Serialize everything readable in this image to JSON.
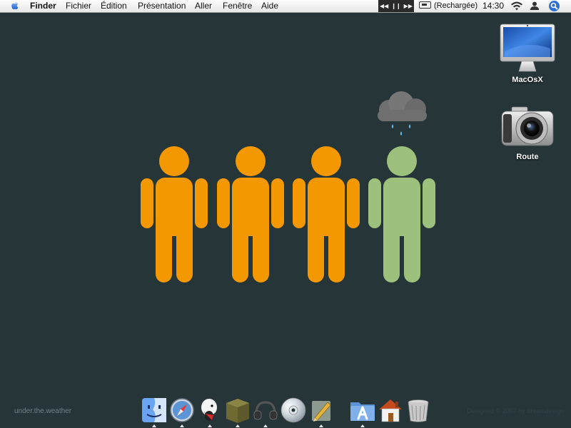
{
  "menubar": {
    "apple_icon": "apple-logo-icon",
    "app_name": "Finder",
    "menus": [
      "Fichier",
      "Édition",
      "Présentation",
      "Aller",
      "Fenêtre",
      "Aide"
    ],
    "media_controls": [
      "previous-icon",
      "pause-icon",
      "next-icon"
    ],
    "battery_status": "(Rechargée)",
    "clock": "14:30",
    "status_icons": [
      "wifi-icon",
      "user-icon",
      "spotlight-icon"
    ]
  },
  "desktop": {
    "background": "#263638",
    "figures": [
      {
        "color": "#f39800",
        "icon": "person-icon"
      },
      {
        "color": "#f39800",
        "icon": "person-icon"
      },
      {
        "color": "#f39800",
        "icon": "person-icon"
      },
      {
        "color": "#9dc07c",
        "icon": "person-icon",
        "accessory": "rain-cloud-icon"
      }
    ],
    "icons": [
      {
        "label": "MacOsX",
        "icon": "imac-icon"
      },
      {
        "label": "Route",
        "icon": "camera-icon"
      }
    ],
    "footer_left": "under.the.weather",
    "footer_right": "Designed © 2007 by dreamdesign"
  },
  "dock": {
    "items": [
      {
        "name": "finder",
        "icon": "finder-icon",
        "running": true
      },
      {
        "name": "safari",
        "icon": "safari-compass-icon",
        "running": true
      },
      {
        "name": "adium",
        "icon": "duck-mascot-icon",
        "running": true
      },
      {
        "name": "box",
        "icon": "box-icon",
        "running": true
      },
      {
        "name": "headphones",
        "icon": "headphones-icon",
        "running": true
      },
      {
        "name": "dvd",
        "icon": "dvd-icon",
        "running": false
      },
      {
        "name": "pencil",
        "icon": "pencil-icon",
        "running": true
      },
      {
        "name": "applications",
        "icon": "applications-folder-icon",
        "running": true
      },
      {
        "name": "home",
        "icon": "home-icon",
        "running": false
      },
      {
        "name": "trash",
        "icon": "trash-icon",
        "running": false
      }
    ]
  }
}
